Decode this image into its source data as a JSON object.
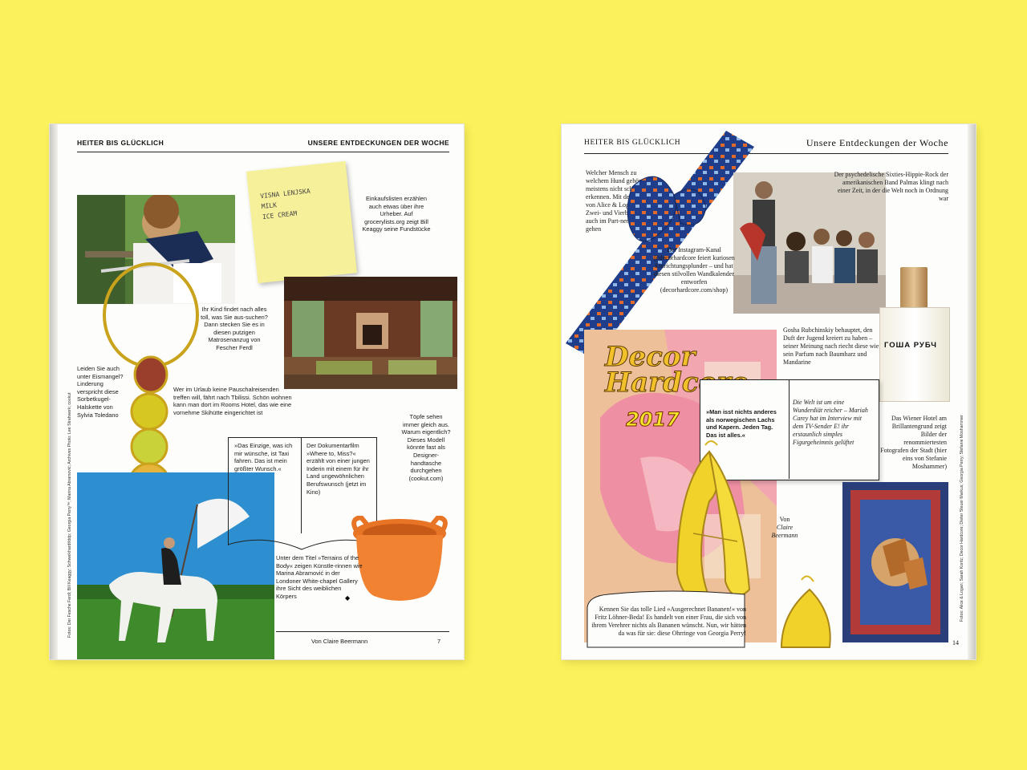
{
  "left_page": {
    "header_left": "HEITER BIS GLÜCKLICH",
    "header_right": "UNSERE ENTDECKUNGEN DER WOCHE",
    "note_card": [
      "VISNA LENJSKA",
      "MILK",
      "ICE CREAM"
    ],
    "grocery_text": "Einkaufslisten erzählen auch etwas über ihre Urheber. Auf grocerylists.org zeigt Bill Keaggy seine Fundstücke",
    "kid_text": "Ihr Kind findet nach alles toll, was Sie aus-suchen? Dann stecken Sie es in diesen putzigen Matrosenanzug von Fescher Ferdl",
    "ice_text": "Leiden Sie auch unter Eismangel? Linderung verspricht diese Sorbetkugel-Halskette von Sylvia Toledano",
    "hotel_text": "Wer im Urlaub keine Pauschalreisenden treffen will, fährt nach Tbilissi. Schön wohnen kann man dort im Rooms Hotel, das wie eine vornehme Skihütte eingerichtet ist",
    "taxi_quote": "»Das Einzige, was ich mir wünsche, ist Taxi fahren. Das ist mein größter Wunsch.«",
    "film_text": "Der Dokumentarfilm »Where to, Miss?« erzählt von einer jungen Inderin mit einem für ihr Land ungewöhnlichen Berufswunsch (jetzt im Kino)",
    "bucket_text": "Töpfe sehen immer gleich aus. Warum eigentlich? Dieses Modell könnte fast als Designer-handtasche durchgehen (cookut.com)",
    "terrains_text": "Unter dem Titel »Terrains of the Body« zeigen Künstle-rinnen wie Marina Abramović in der Londoner White-chapel Gallery ihre Sicht des weiblichen Körpers",
    "end_mark": "◆",
    "byline": "Von Claire Beermann",
    "page_number": "7",
    "credit": "Fotos: Der Fesche Ferdl; Bill Keaggy; Schweikhardt/ddp; Georgia Perry™; Marina Abramović; Archives Photo: Lee Strahwerk; cookut"
  },
  "right_page": {
    "header_left": "HEITER BIS GLÜCKLICH",
    "header_right": "Unsere Entdeckungen der Woche",
    "dog_text": "Welcher Mensch zu welchem Hund gehört, ist meistens nicht schwer zu erkennen. Mit den Fliegen von Alice & Logan können Zwei- und Vierbeiner jetzt auch im Part-nerlook gehen",
    "band_text": "Der psychedelische Sixties-Hippie-Rock der amerikanischen Band Palmas klingt nach einer Zeit, in der die Welt noch in Ordnung war",
    "instagram_text": "Der Instagram-Kanal @decorhardcore feiert kuriosen Einrichtungsplunder – und hat diesen stilvollen Wandkalender entworfen (decorhardcore.com/shop)",
    "perfume_text": "Gosha Rubchinskiy behauptet, den Duft der Jugend kreiert zu haben – seiner Meinung nach riecht diese wie sein Parfum nach Baumharz und Mandarine",
    "perfume_label": "ГОША РУБЧ",
    "calendar_title_1": "Decor",
    "calendar_title_2": "Hardcore",
    "calendar_year": "2017",
    "quote_lachs": "»Man isst nichts anderes als norwegischen Lachs und Kapern. Jeden Tag. Das ist alles.«",
    "quote_carey": "Die Welt ist um eine Wunderdiät reicher – Mariah Carey hat im Interview mit dem TV-Sender E! ihr erstaunlich simples Figurgeheimnis gelüftet",
    "hotel_text": "Das Wiener Hotel am Brillantengrund zeigt Bilder der renommiertesten Fotografen der Stadt (hier eins von Stefanie Moshammer)",
    "byline_1": "Von",
    "byline_2": "Claire Beermann",
    "banana_text": "Kennen Sie das tolle Lied »Ausgerechnet Bananen!« von Fritz Löhner-Beda! Es handelt von einer Frau, die sich von ihrem Verehrer nichts als Bananen wünscht. Nun, wir hätten da was für sie: diese Ohrringe von Georgia Perry!",
    "page_number": "14",
    "credit": "Fotos: Alice & Logan; Sarah Kontz; Decor Hardcore; Dieter Steuer Markus; Georgia Perry; Stefanie Moshammer"
  },
  "colors": {
    "background": "#fbf15a",
    "paper": "#fdfdfb",
    "ink": "#1a1a1a"
  }
}
